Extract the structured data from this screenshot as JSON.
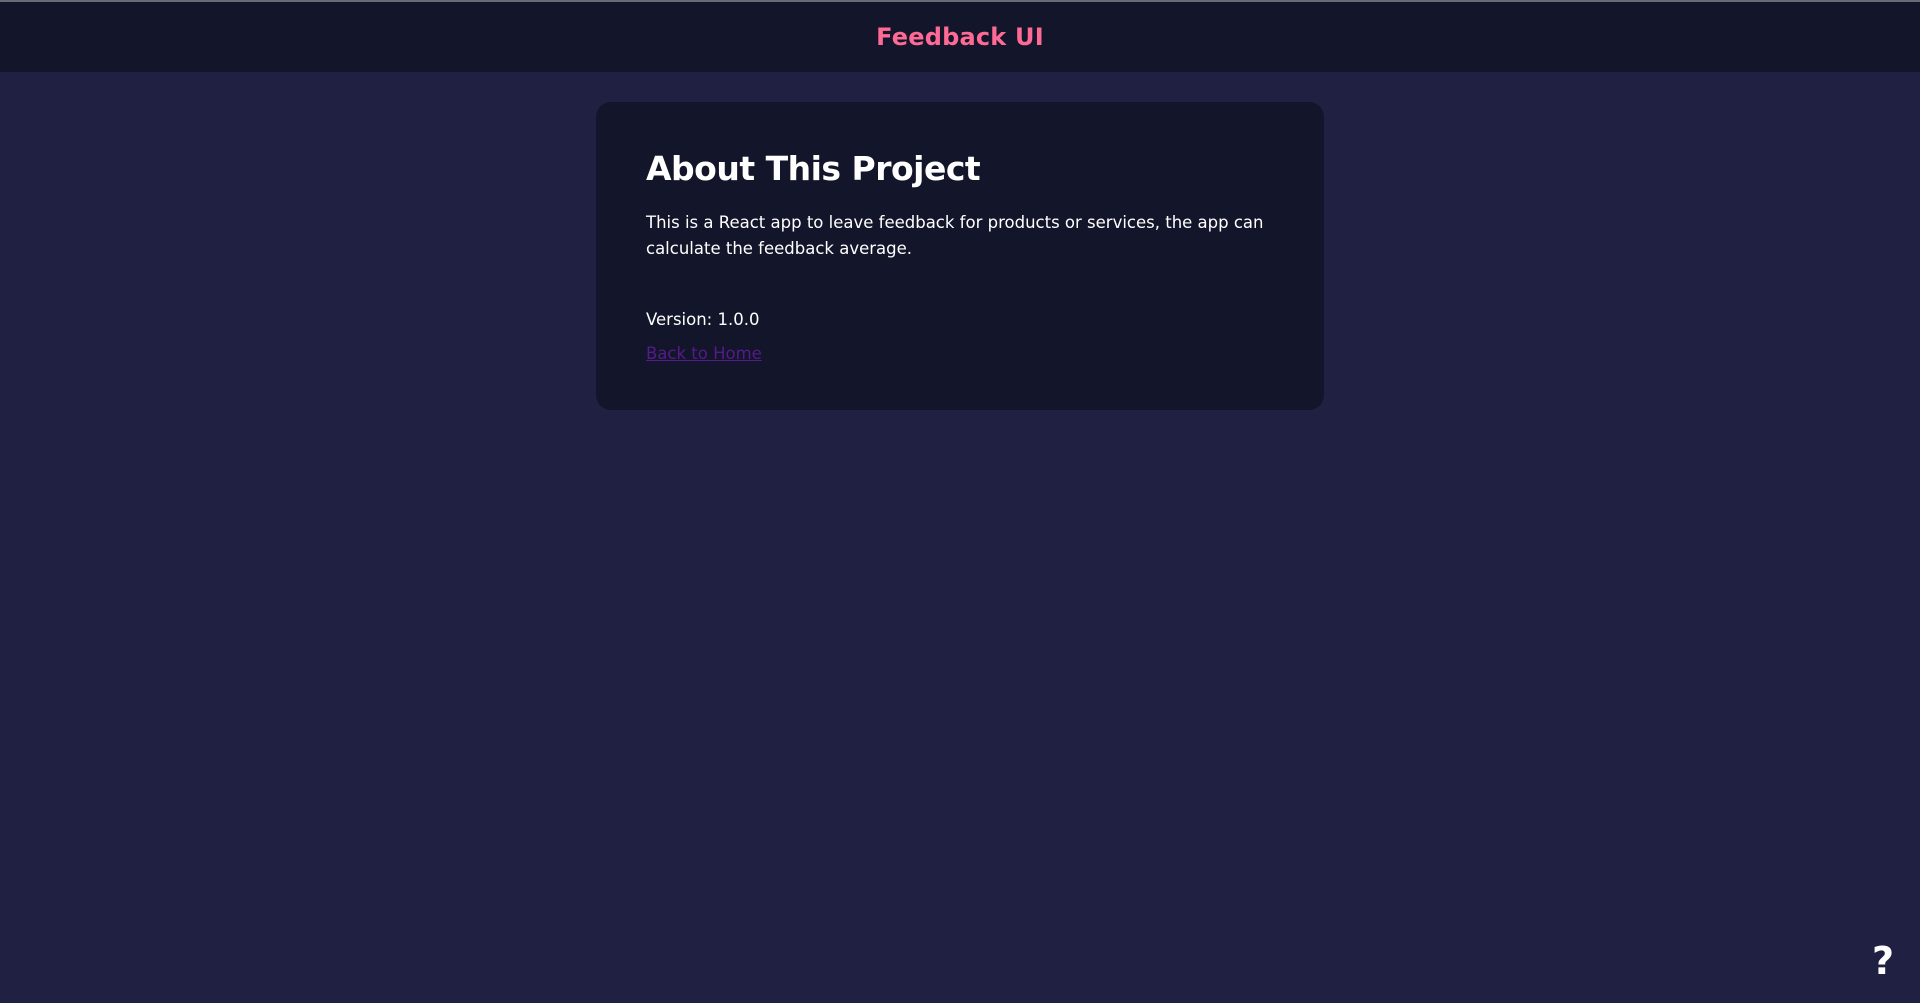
{
  "header": {
    "title": "Feedback UI"
  },
  "about": {
    "title": "About This Project",
    "description": "This is a React app to leave feedback for products or services, the app can calculate the feedback average.",
    "version_label": "Version: 1.0.0",
    "back_link_label": "Back to Home"
  },
  "help": {
    "icon": "question-icon",
    "glyph": "?"
  },
  "colors": {
    "page_background": "#202142",
    "header_background": "#13152a",
    "card_background": "#13152a",
    "brand_accent": "#ff6a95",
    "link_visited": "#551a8b",
    "text": "#ffffff"
  }
}
